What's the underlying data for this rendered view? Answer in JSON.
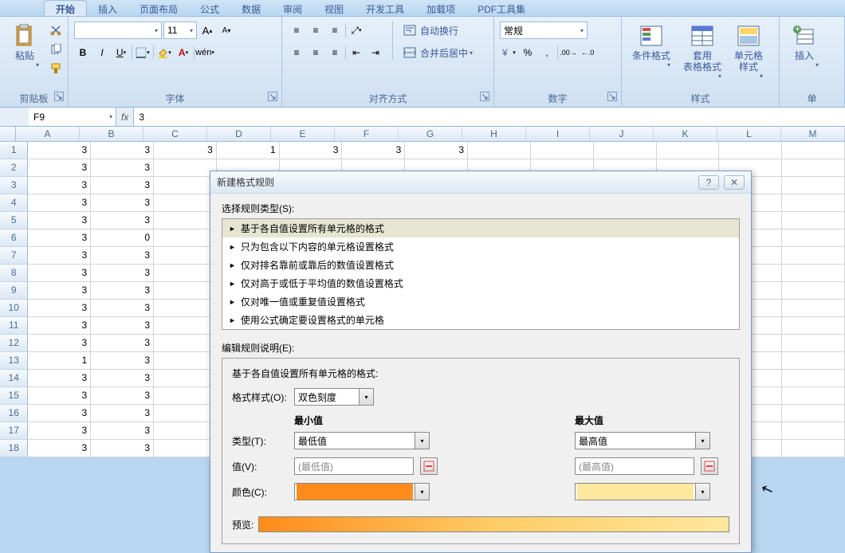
{
  "tabs": [
    "开始",
    "插入",
    "页面布局",
    "公式",
    "数据",
    "审阅",
    "视图",
    "开发工具",
    "加载项",
    "PDF工具集"
  ],
  "active_tab": 0,
  "ribbon": {
    "clipboard": {
      "label": "剪贴板",
      "paste": "粘贴"
    },
    "font": {
      "label": "字体",
      "name": "",
      "size": "11"
    },
    "align": {
      "label": "对齐方式",
      "wrap": "自动换行",
      "merge": "合并后居中"
    },
    "number": {
      "label": "数字",
      "format": "常规"
    },
    "styles": {
      "label": "样式",
      "cond": "条件格式",
      "table": "套用\n表格格式",
      "cell": "单元格\n样式"
    },
    "cells": {
      "label": "单",
      "insert": "插入"
    }
  },
  "formula_bar": {
    "name_box": "F9",
    "value": "3"
  },
  "columns": [
    "A",
    "B",
    "C",
    "D",
    "E",
    "F",
    "G",
    "H",
    "I",
    "J",
    "K",
    "L",
    "M"
  ],
  "rows": [
    {
      "n": 1,
      "c": [
        "3",
        "3",
        "3",
        "1",
        "3",
        "3",
        "3",
        "",
        "",
        "",
        "",
        "",
        ""
      ]
    },
    {
      "n": 2,
      "c": [
        "3",
        "3",
        "",
        "",
        "",
        "",
        "",
        "",
        "",
        "",
        "",
        "",
        ""
      ]
    },
    {
      "n": 3,
      "c": [
        "3",
        "3",
        "",
        "",
        "",
        "",
        "",
        "",
        "",
        "",
        "",
        "",
        ""
      ]
    },
    {
      "n": 4,
      "c": [
        "3",
        "3",
        "",
        "",
        "",
        "",
        "",
        "",
        "",
        "",
        "",
        "",
        ""
      ]
    },
    {
      "n": 5,
      "c": [
        "3",
        "3",
        "",
        "",
        "",
        "",
        "",
        "",
        "",
        "",
        "",
        "",
        ""
      ]
    },
    {
      "n": 6,
      "c": [
        "3",
        "0",
        "",
        "",
        "",
        "",
        "",
        "",
        "",
        "",
        "",
        "",
        ""
      ]
    },
    {
      "n": 7,
      "c": [
        "3",
        "3",
        "",
        "",
        "",
        "",
        "",
        "",
        "",
        "",
        "",
        "",
        ""
      ]
    },
    {
      "n": 8,
      "c": [
        "3",
        "3",
        "",
        "",
        "",
        "",
        "",
        "",
        "",
        "",
        "",
        "",
        ""
      ]
    },
    {
      "n": 9,
      "c": [
        "3",
        "3",
        "",
        "",
        "",
        "",
        "",
        "",
        "",
        "",
        "",
        "",
        ""
      ]
    },
    {
      "n": 10,
      "c": [
        "3",
        "3",
        "",
        "",
        "",
        "",
        "",
        "",
        "",
        "",
        "",
        "",
        ""
      ]
    },
    {
      "n": 11,
      "c": [
        "3",
        "3",
        "",
        "",
        "",
        "",
        "",
        "",
        "",
        "",
        "",
        "",
        ""
      ]
    },
    {
      "n": 12,
      "c": [
        "3",
        "3",
        "",
        "",
        "",
        "",
        "",
        "",
        "",
        "",
        "",
        "",
        ""
      ]
    },
    {
      "n": 13,
      "c": [
        "1",
        "3",
        "",
        "",
        "",
        "",
        "",
        "",
        "",
        "",
        "",
        "",
        ""
      ]
    },
    {
      "n": 14,
      "c": [
        "3",
        "3",
        "",
        "",
        "",
        "",
        "",
        "",
        "",
        "",
        "",
        "",
        ""
      ]
    },
    {
      "n": 15,
      "c": [
        "3",
        "3",
        "",
        "",
        "",
        "",
        "",
        "",
        "",
        "",
        "",
        "",
        ""
      ]
    },
    {
      "n": 16,
      "c": [
        "3",
        "3",
        "",
        "",
        "",
        "",
        "",
        "",
        "",
        "",
        "",
        "",
        ""
      ]
    },
    {
      "n": 17,
      "c": [
        "3",
        "3",
        "",
        "",
        "",
        "",
        "",
        "",
        "",
        "",
        "",
        "",
        ""
      ]
    },
    {
      "n": 18,
      "c": [
        "3",
        "3",
        "",
        "",
        "",
        "",
        "",
        "",
        "",
        "",
        "",
        "",
        ""
      ]
    }
  ],
  "dialog": {
    "title": "新建格式规则",
    "select_label": "选择规则类型(S):",
    "rules": [
      "基于各自值设置所有单元格的格式",
      "只为包含以下内容的单元格设置格式",
      "仅对排名靠前或靠后的数值设置格式",
      "仅对高于或低于平均值的数值设置格式",
      "仅对唯一值或重复值设置格式",
      "使用公式确定要设置格式的单元格"
    ],
    "edit_label": "编辑规则说明(E):",
    "edit_heading": "基于各自值设置所有单元格的格式:",
    "format_style_lbl": "格式样式(O):",
    "format_style_val": "双色刻度",
    "min_head": "最小值",
    "max_head": "最大值",
    "type_lbl": "类型(T):",
    "type_min": "最低值",
    "type_max": "最高值",
    "value_lbl": "值(V):",
    "value_min_ph": "(最低值)",
    "value_max_ph": "(最高值)",
    "color_lbl": "颜色(C):",
    "color_min": "#ff8c1a",
    "color_max": "#ffe89e",
    "preview_lbl": "预览:"
  }
}
